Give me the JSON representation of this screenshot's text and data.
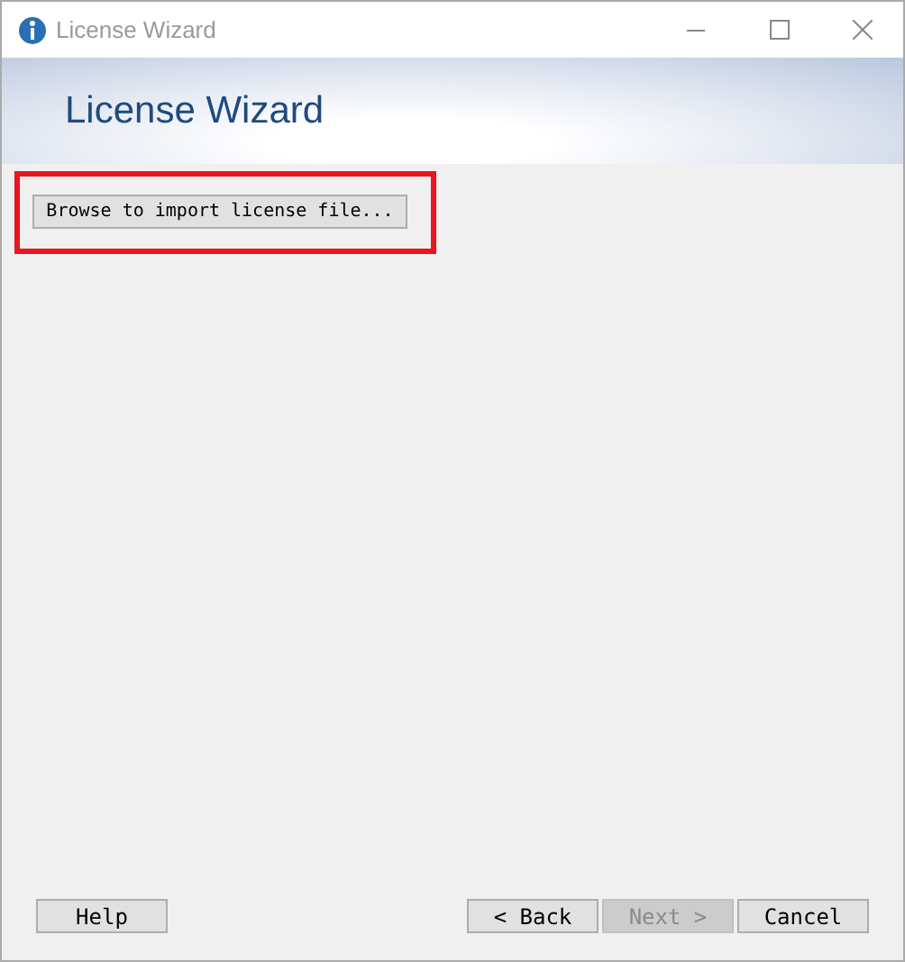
{
  "window": {
    "title": "License Wizard"
  },
  "header": {
    "title": "License Wizard"
  },
  "browse_button": {
    "label": "Browse to import license file...",
    "highlighted": true
  },
  "buttons": [
    {
      "label": "Help",
      "disabled": false
    },
    {
      "label": "< Back",
      "disabled": false
    },
    {
      "label": "Next >",
      "disabled": true
    },
    {
      "label": "Cancel",
      "disabled": false
    }
  ]
}
